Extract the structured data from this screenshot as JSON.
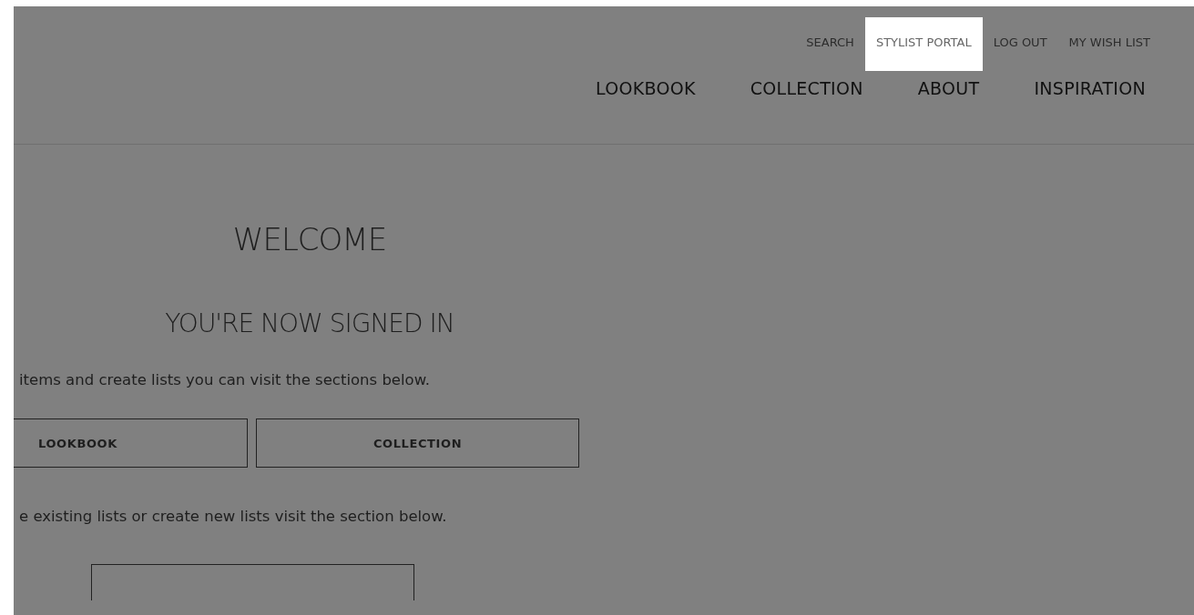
{
  "utility_links": [
    {
      "label": "SEARCH",
      "selected": false
    },
    {
      "label": "STYLIST PORTAL",
      "selected": true
    },
    {
      "label": "LOG OUT",
      "selected": false
    },
    {
      "label": "MY WISH LIST",
      "selected": false
    }
  ],
  "main_nav": [
    "LOOKBOOK",
    "COLLECTION",
    "ABOUT",
    "INSPIRATION"
  ],
  "welcome": {
    "title": "WELCOME",
    "subtitle": "YOU'RE NOW SIGNED IN",
    "intro": "items and create lists you can visit the sections below.",
    "section_buttons": [
      "LOOKBOOK",
      "COLLECTION"
    ],
    "lists_text": "e existing lists or create new lists visit the section below."
  }
}
